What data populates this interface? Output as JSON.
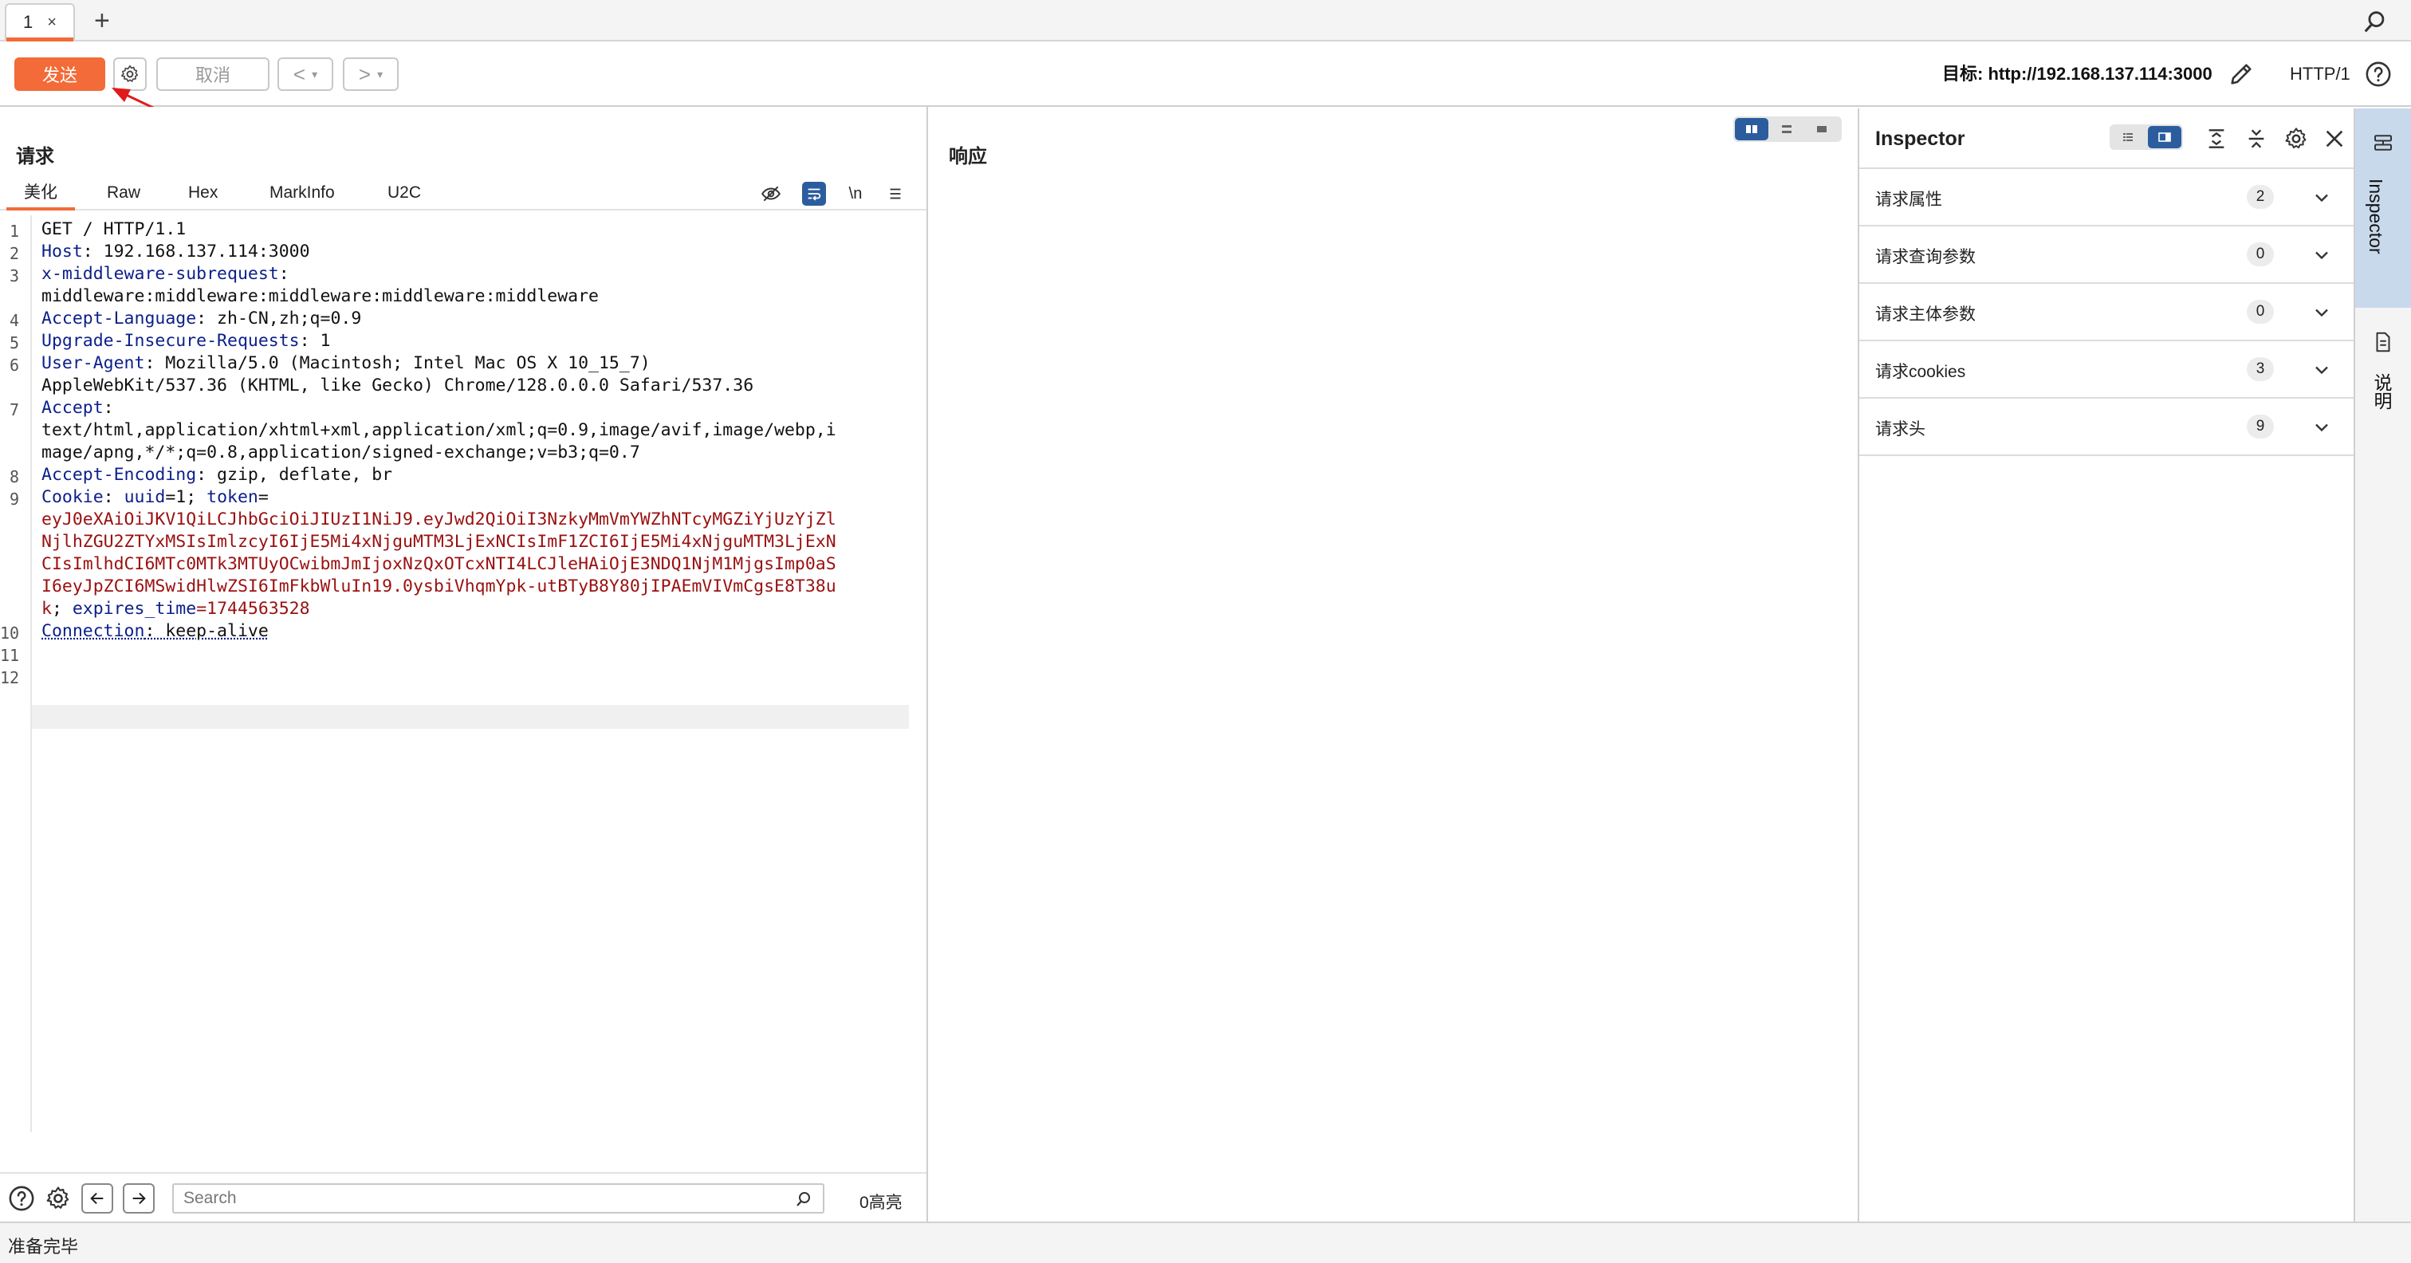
{
  "tabs": [
    {
      "label": "1",
      "close": "×"
    }
  ],
  "tab_add": "+",
  "toolbar": {
    "send_label": "发送",
    "cancel_label": "取消",
    "back_label": "<",
    "forward_label": ">",
    "dropdown_glyph": "▾",
    "target_label": "目标: http://192.168.137.114:3000",
    "http_version": "HTTP/1"
  },
  "request": {
    "title": "请求",
    "tabs": [
      "美化",
      "Raw",
      "Hex",
      "MarkInfo",
      "U2C"
    ],
    "active_tab": "美化",
    "newline_toggle": "\\n",
    "line_numbers": [
      "1",
      "2",
      "3",
      "4",
      "5",
      "6",
      "7",
      "8",
      "9",
      "10",
      "11",
      "12"
    ],
    "lines": {
      "l1": "GET / HTTP/1.1",
      "l2_key": "Host",
      "l2_val": ": 192.168.137.114:3000",
      "l3_key": "x-middleware-subrequest",
      "l3_val": ":",
      "l3_cont": "middleware:middleware:middleware:middleware:middleware",
      "l4_key": "Accept-Language",
      "l4_val": ": zh-CN,zh;q=0.9",
      "l5_key": "Upgrade-Insecure-Requests",
      "l5_val": ": 1",
      "l6_key": "User-Agent",
      "l6_val": ": Mozilla/5.0 (Macintosh; Intel Mac OS X 10_15_7)",
      "l6_cont": "AppleWebKit/537.36 (KHTML, like Gecko) Chrome/128.0.0.0 Safari/537.36",
      "l7_key": "Accept",
      "l7_val": ":",
      "l7_cont1": "text/html,application/xhtml+xml,application/xml;q=0.9,image/avif,image/webp,i",
      "l7_cont2": "mage/apng,*/*;q=0.8,application/signed-exchange;v=b3;q=0.7",
      "l8_key": "Accept-Encoding",
      "l8_val": ": gzip, deflate, br",
      "l9_key": "Cookie",
      "l9_mid": ": ",
      "l9_uuid_key": "uuid",
      "l9_uuid_val": "=1",
      "l9_sep": "; ",
      "l9_token_key": "token",
      "l9_token_eq": "=",
      "token_lines": [
        "eyJ0eXAiOiJKV1QiLCJhbGciOiJIUzI1NiJ9.eyJwd2QiOiI3NzkyMmVmYWZhNTcyMGZiYjUzYjZl",
        "NjlhZGU2ZTYxMSIsImlzcyI6IjE5Mi4xNjguMTM3LjExNCIsImF1ZCI6IjE5Mi4xNjguMTM3LjExN",
        "CIsImlhdCI6MTc0MTk3MTUyOCwibmJmIjoxNzQxOTcxNTI4LCJleHAiOjE3NDQ1NjM1MjgsImp0aS",
        "I6eyJpZCI6MSwidHlwZSI6ImFkbWluIn19.0ysbiVhqmYpk-utBTyB8Y80jIPAEmVIVmCgsE8T38u"
      ],
      "l9_last_token": "k",
      "l9_exp_sep": "; ",
      "l9_exp_key": "expires_time",
      "l9_exp_val": "=1744563528",
      "l10_key": "Connection",
      "l10_val": ": keep-alive"
    },
    "search_placeholder": "Search",
    "highlight_count": "0高亮"
  },
  "response": {
    "title": "响应"
  },
  "inspector": {
    "title": "Inspector",
    "rows": [
      {
        "label": "请求属性",
        "count": "2"
      },
      {
        "label": "请求查询参数",
        "count": "0"
      },
      {
        "label": "请求主体参数",
        "count": "0"
      },
      {
        "label": "请求cookies",
        "count": "3"
      },
      {
        "label": "请求头",
        "count": "9"
      }
    ]
  },
  "side_rail": {
    "inspector_label": "Inspector",
    "notes_label": "说明"
  },
  "status": {
    "text": "准备完毕"
  },
  "colors": {
    "accent": "#f26b38",
    "header_key": "#0b1f8a",
    "token": "#9a1010",
    "toggle_active": "#2b5d9e"
  }
}
